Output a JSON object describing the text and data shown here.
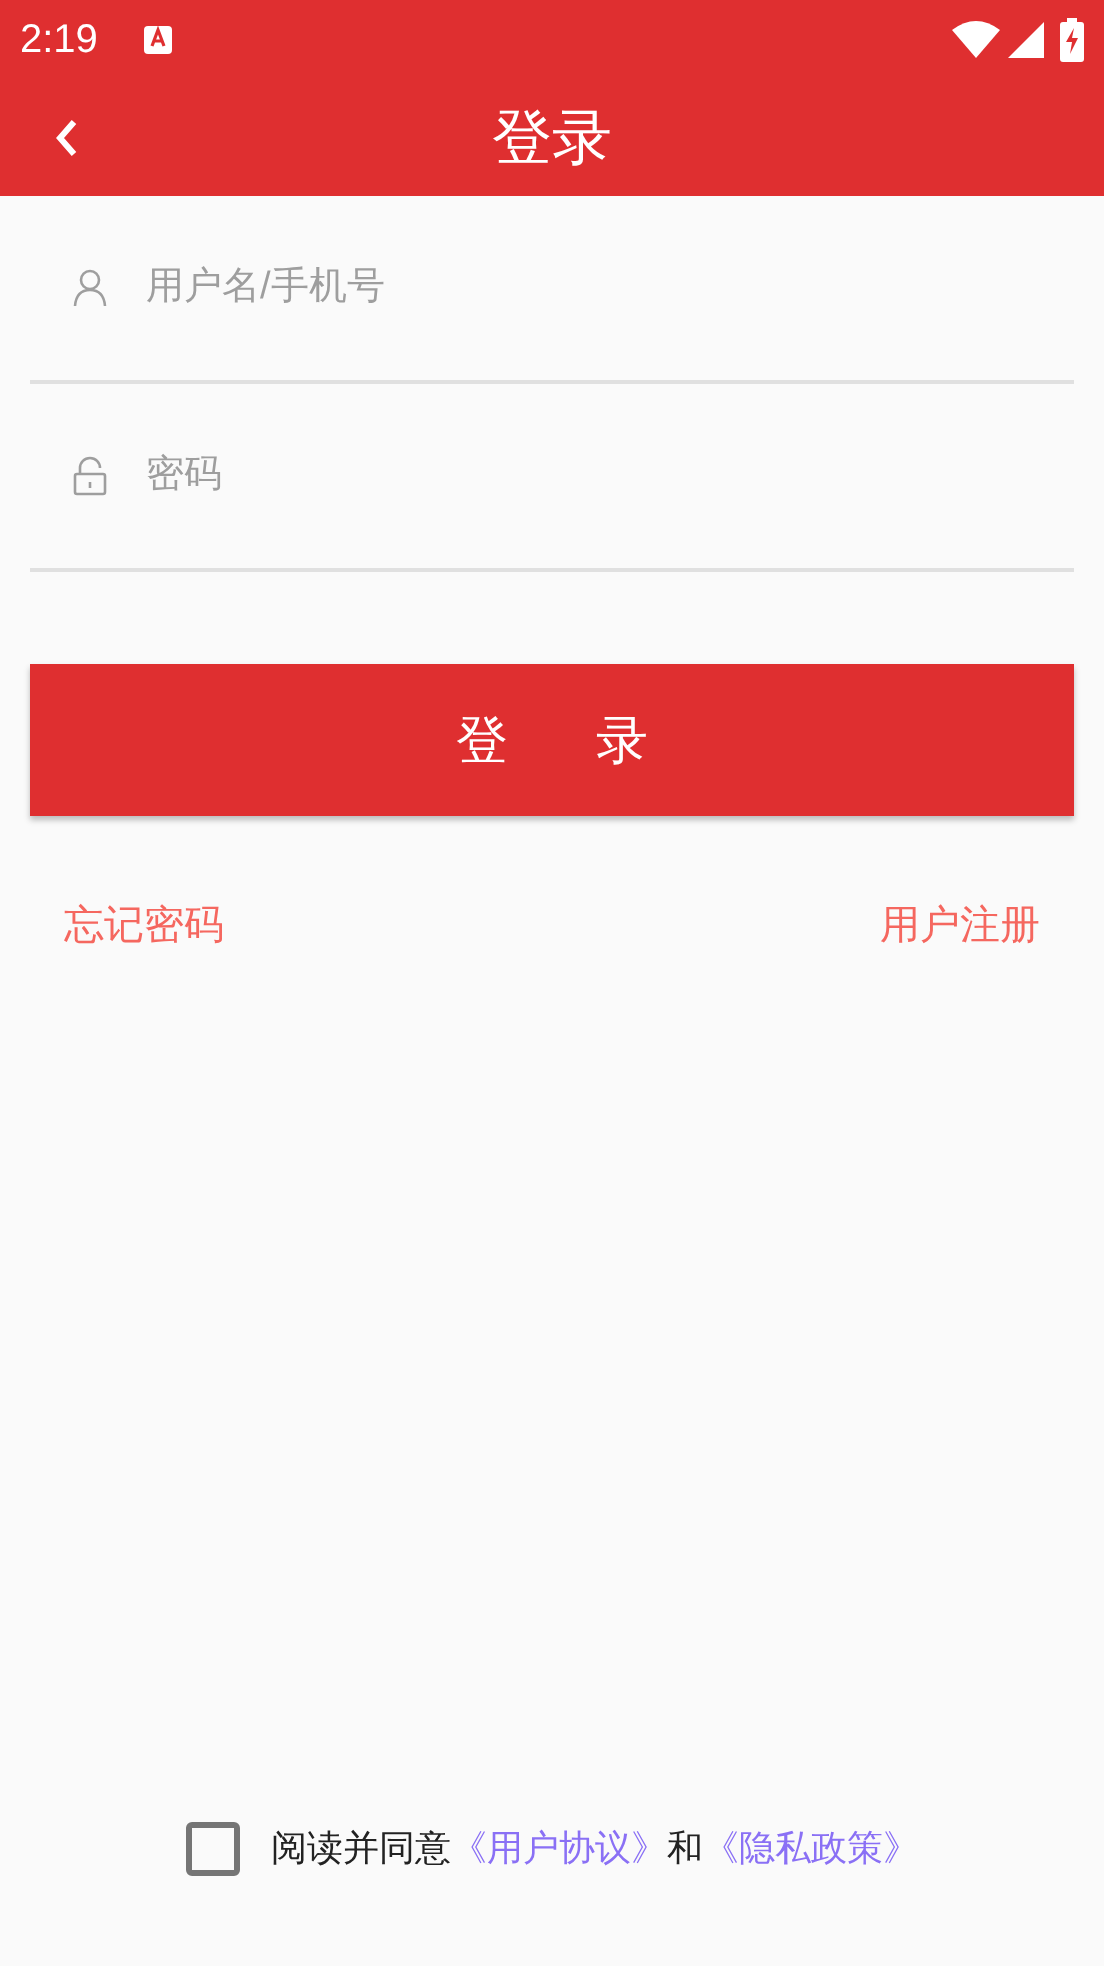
{
  "status_bar": {
    "time": "2:19"
  },
  "toolbar": {
    "title": "登录"
  },
  "fields": [
    {
      "kind": "user",
      "placeholder": "用户名/手机号"
    },
    {
      "kind": "lock",
      "placeholder": "密码"
    }
  ],
  "login_button": "登录",
  "links": [
    "忘记密码",
    "用户注册"
  ],
  "agreement": {
    "checked": false,
    "parts": [
      {
        "kind": "text",
        "text": "阅读并同意"
      },
      {
        "kind": "link",
        "text": "《用户协议》"
      },
      {
        "kind": "text",
        "text": "和"
      },
      {
        "kind": "link",
        "text": "《隐私政策》"
      }
    ]
  }
}
